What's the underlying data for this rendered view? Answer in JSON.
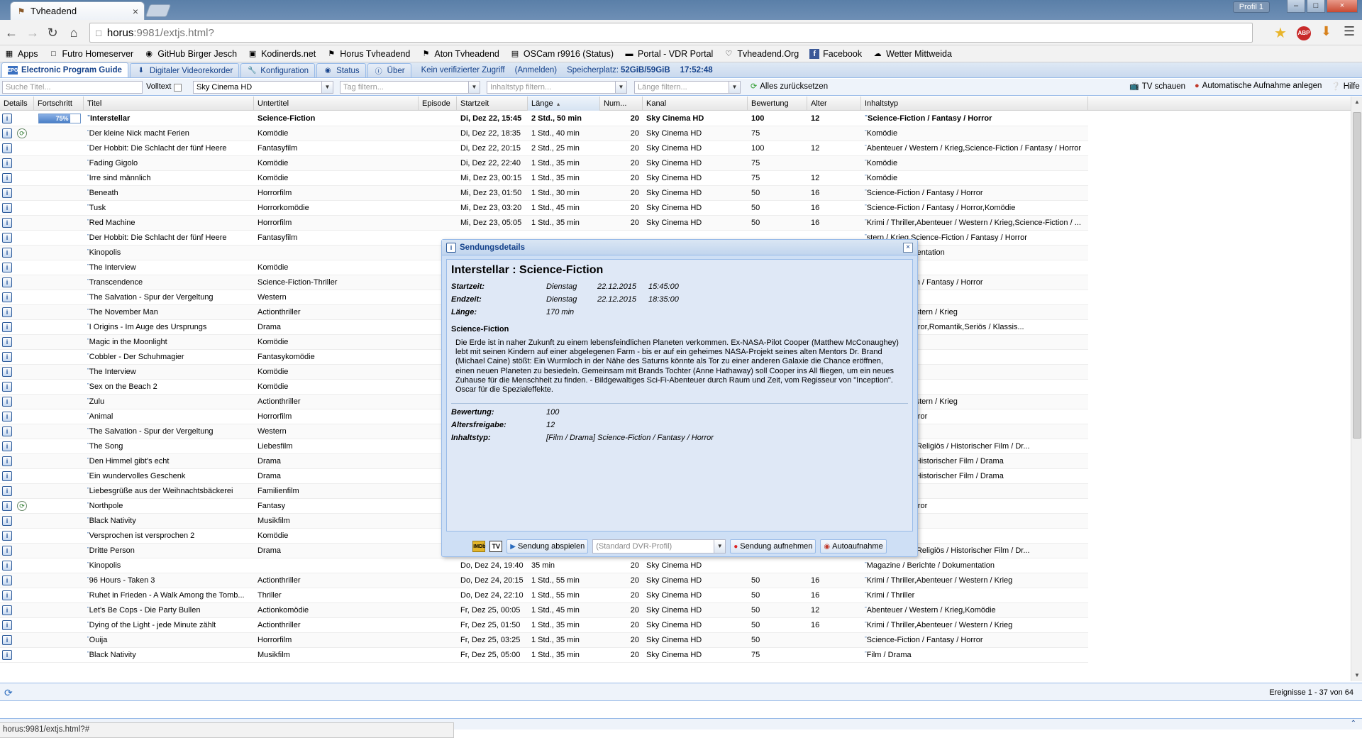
{
  "browser": {
    "tab_title": "Tvheadend",
    "profile": "Profil 1",
    "url_host": "horus",
    "url_path": ":9981/extjs.html?",
    "status_url": "horus:9981/extjs.html?#"
  },
  "bookmarks": [
    {
      "label": "Apps",
      "icon": "apps-grid-icon"
    },
    {
      "label": "Futro Homeserver",
      "icon": "page-icon"
    },
    {
      "label": "GitHub Birger Jesch",
      "icon": "github-icon"
    },
    {
      "label": "Kodinerds.net",
      "icon": "kodinerds-icon"
    },
    {
      "label": "Horus Tvheadend",
      "icon": "tvheadend-icon"
    },
    {
      "label": "Aton Tvheadend",
      "icon": "tvheadend-icon"
    },
    {
      "label": "OSCam r9916 (Status)",
      "icon": "oscam-icon"
    },
    {
      "label": "Portal - VDR Portal",
      "icon": "vdr-icon"
    },
    {
      "label": "Tvheadend.Org",
      "icon": "tvheadend-org-icon"
    },
    {
      "label": "Facebook",
      "icon": "facebook-icon"
    },
    {
      "label": "Wetter Mittweida",
      "icon": "weather-icon"
    }
  ],
  "app_tabs": [
    {
      "label": "Electronic Program Guide",
      "active": true
    },
    {
      "label": "Digitaler Videorekorder"
    },
    {
      "label": "Konfiguration"
    },
    {
      "label": "Status"
    },
    {
      "label": "Über"
    }
  ],
  "app_info": {
    "access": "Kein verifizierter Zugriff",
    "login": "(Anmelden)",
    "storage_label": "Speicherplatz:",
    "storage_value": "52GiB/59GiB",
    "time": "17:52:48"
  },
  "toolbar": {
    "title_placeholder": "Suche Titel...",
    "fulltext_label": "Volltext",
    "channel_value": "Sky Cinema HD",
    "tag_placeholder": "Tag filtern...",
    "content_placeholder": "Inhaltstyp filtern...",
    "length_placeholder": "Länge filtern...",
    "reset_label": "Alles zurücksetzen",
    "watch_tv": "TV schauen",
    "auto_record": "Automatische Aufnahme anlegen",
    "help": "Hilfe"
  },
  "columns": [
    "Details",
    "Fortschritt",
    "Titel",
    "Untertitel",
    "Episode",
    "Startzeit",
    "Länge",
    "Num...",
    "Kanal",
    "Bewertung",
    "Alter",
    "Inhaltstyp"
  ],
  "rows": [
    {
      "progress": 0.75,
      "progress_label": "75%",
      "title": "Interstellar",
      "subtitle": "Science-Fiction",
      "start": "Di, Dez 22, 15:45",
      "length": "2 Std., 50 min",
      "num": "20",
      "channel": "Sky Cinema HD",
      "rating": "100",
      "age": "12",
      "genre": "Science-Fiction / Fantasy / Horror",
      "selected": true
    },
    {
      "title": "Der kleine Nick macht Ferien",
      "subtitle": "Komödie",
      "start": "Di, Dez 22, 18:35",
      "length": "1 Std., 40 min",
      "num": "20",
      "channel": "Sky Cinema HD",
      "rating": "75",
      "age": "",
      "genre": "Komödie",
      "rec": true
    },
    {
      "title": "Der Hobbit: Die Schlacht der fünf Heere",
      "subtitle": "Fantasyfilm",
      "start": "Di, Dez 22, 20:15",
      "length": "2 Std., 25 min",
      "num": "20",
      "channel": "Sky Cinema HD",
      "rating": "100",
      "age": "12",
      "genre": "Abenteuer / Western / Krieg,Science-Fiction / Fantasy / Horror"
    },
    {
      "title": "Fading Gigolo",
      "subtitle": "Komödie",
      "start": "Di, Dez 22, 22:40",
      "length": "1 Std., 35 min",
      "num": "20",
      "channel": "Sky Cinema HD",
      "rating": "75",
      "age": "",
      "genre": "Komödie"
    },
    {
      "title": "Irre sind männlich",
      "subtitle": "Komödie",
      "start": "Mi, Dez 23, 00:15",
      "length": "1 Std., 35 min",
      "num": "20",
      "channel": "Sky Cinema HD",
      "rating": "75",
      "age": "12",
      "genre": "Komödie"
    },
    {
      "title": "Beneath",
      "subtitle": "Horrorfilm",
      "start": "Mi, Dez 23, 01:50",
      "length": "1 Std., 30 min",
      "num": "20",
      "channel": "Sky Cinema HD",
      "rating": "50",
      "age": "16",
      "genre": "Science-Fiction / Fantasy / Horror"
    },
    {
      "title": "Tusk",
      "subtitle": "Horrorkomödie",
      "start": "Mi, Dez 23, 03:20",
      "length": "1 Std., 45 min",
      "num": "20",
      "channel": "Sky Cinema HD",
      "rating": "50",
      "age": "16",
      "genre": "Science-Fiction / Fantasy / Horror,Komödie"
    },
    {
      "title": "Red Machine",
      "subtitle": "Horrorfilm",
      "start": "Mi, Dez 23, 05:05",
      "length": "1 Std., 35 min",
      "num": "20",
      "channel": "Sky Cinema HD",
      "rating": "50",
      "age": "16",
      "genre": "Krimi / Thriller,Abenteuer / Western / Krieg,Science-Fiction / ..."
    },
    {
      "title": "Der Hobbit: Die Schlacht der fünf Heere",
      "subtitle": "Fantasyfilm",
      "genre": "stern / Krieg,Science-Fiction / Fantasy / Horror"
    },
    {
      "title": "Kinopolis",
      "subtitle": "",
      "genre": "richte / Dokumentation"
    },
    {
      "title": "The Interview",
      "subtitle": "Komödie",
      "genre": ""
    },
    {
      "title": "Transcendence",
      "subtitle": "Science-Fiction-Thriller",
      "genre": "Science-Fiction / Fantasy / Horror"
    },
    {
      "title": "The Salvation - Spur der Vergeltung",
      "subtitle": "Western",
      "genre": "stern / Krieg"
    },
    {
      "title": "The November Man",
      "subtitle": "Actionthriller",
      "genre": "benteuer / Western / Krieg"
    },
    {
      "title": "I Origins - Im Auge des Ursprungs",
      "subtitle": "Drama",
      "genre": "/ Fantasy / Horror,Romantik,Seriös / Klassis..."
    },
    {
      "title": "Magic in the Moonlight",
      "subtitle": "Komödie",
      "genre": ""
    },
    {
      "title": "Cobbler - Der Schuhmagier",
      "subtitle": "Fantasykomödie",
      "genre": ""
    },
    {
      "title": "The Interview",
      "subtitle": "Komödie",
      "genre": ""
    },
    {
      "title": "Sex on the Beach 2",
      "subtitle": "Komödie",
      "genre": ""
    },
    {
      "title": "Zulu",
      "subtitle": "Actionthriller",
      "genre": "benteuer / Western / Krieg"
    },
    {
      "title": "Animal",
      "subtitle": "Horrorfilm",
      "genre": "/ Fantasy / Horror"
    },
    {
      "title": "The Salvation - Spur der Vergeltung",
      "subtitle": "Western",
      "genre": "stern / Krieg"
    },
    {
      "title": "The Song",
      "subtitle": "Liebesfilm",
      "genre": "s / Klassisch / Religiös / Historischer Film / Dr..."
    },
    {
      "title": "Den Himmel gibt's echt",
      "subtitle": "Drama",
      "genre": "ch / Religiös / Historischer Film / Drama"
    },
    {
      "title": "Ein wundervolles Geschenk",
      "subtitle": "Drama",
      "genre": "ch / Religiös / Historischer Film / Drama"
    },
    {
      "title": "Liebesgrüße aus der Weihnachtsbäckerei",
      "subtitle": "Familienfilm",
      "genre": ""
    },
    {
      "title": "Northpole",
      "subtitle": "Fantasy",
      "genre": "/ Fantasy / Horror",
      "rec": true
    },
    {
      "title": "Black Nativity",
      "subtitle": "Musikfilm",
      "genre": ""
    },
    {
      "title": "Versprochen ist versprochen 2",
      "subtitle": "Komödie",
      "genre": ""
    },
    {
      "title": "Dritte Person",
      "subtitle": "Drama",
      "genre": "s / Klassisch / Religiös / Historischer Film / Dr..."
    },
    {
      "title": "Kinopolis",
      "subtitle": "",
      "start": "Do, Dez 24, 19:40",
      "length": "35 min",
      "num": "20",
      "channel": "Sky Cinema HD",
      "rating": "",
      "age": "",
      "genre": "Magazine / Berichte / Dokumentation"
    },
    {
      "title": "96 Hours - Taken 3",
      "subtitle": "Actionthriller",
      "start": "Do, Dez 24, 20:15",
      "length": "1 Std., 55 min",
      "num": "20",
      "channel": "Sky Cinema HD",
      "rating": "50",
      "age": "16",
      "genre": "Krimi / Thriller,Abenteuer / Western / Krieg"
    },
    {
      "title": "Ruhet in Frieden - A Walk Among the Tomb...",
      "subtitle": "Thriller",
      "start": "Do, Dez 24, 22:10",
      "length": "1 Std., 55 min",
      "num": "20",
      "channel": "Sky Cinema HD",
      "rating": "50",
      "age": "16",
      "genre": "Krimi / Thriller"
    },
    {
      "title": "Let's Be Cops - Die Party Bullen",
      "subtitle": "Actionkomödie",
      "start": "Fr, Dez 25, 00:05",
      "length": "1 Std., 45 min",
      "num": "20",
      "channel": "Sky Cinema HD",
      "rating": "50",
      "age": "12",
      "genre": "Abenteuer / Western / Krieg,Komödie"
    },
    {
      "title": "Dying of the Light - jede Minute zählt",
      "subtitle": "Actionthriller",
      "start": "Fr, Dez 25, 01:50",
      "length": "1 Std., 35 min",
      "num": "20",
      "channel": "Sky Cinema HD",
      "rating": "50",
      "age": "16",
      "genre": "Krimi / Thriller,Abenteuer / Western / Krieg"
    },
    {
      "title": "Ouija",
      "subtitle": "Horrorfilm",
      "start": "Fr, Dez 25, 03:25",
      "length": "1 Std., 35 min",
      "num": "20",
      "channel": "Sky Cinema HD",
      "rating": "50",
      "age": "",
      "genre": "Science-Fiction / Fantasy / Horror"
    },
    {
      "title": "Black Nativity",
      "subtitle": "Musikfilm",
      "start": "Fr, Dez 25, 05:00",
      "length": "1 Std., 35 min",
      "num": "20",
      "channel": "Sky Cinema HD",
      "rating": "75",
      "age": "",
      "genre": "Film / Drama"
    }
  ],
  "pager": {
    "count": "Ereignisse 1 - 37 von 64"
  },
  "dialog": {
    "header": "Sendungsdetails",
    "title": "Interstellar : Science-Fiction",
    "start_label": "Startzeit:",
    "start_day": "Dienstag",
    "start_date": "22.12.2015",
    "start_time": "15:45:00",
    "end_label": "Endzeit:",
    "end_day": "Dienstag",
    "end_date": "22.12.2015",
    "end_time": "18:35:00",
    "length_label": "Länge:",
    "length_value": "170 min",
    "genre": "Science-Fiction",
    "description": "Die Erde ist in naher Zukunft zu einem lebensfeindlichen Planeten verkommen. Ex-NASA-Pilot Cooper (Matthew McConaughey) lebt mit seinen Kindern auf einer abgelegenen Farm - bis er auf ein geheimes NASA-Projekt seines alten Mentors Dr. Brand (Michael Caine) stößt: Ein Wurmloch in der Nähe des Saturns könnte als Tor zu einer anderen Galaxie die Chance eröffnen, einen neuen Planeten zu besiedeln. Gemeinsam mit Brands Tochter (Anne Hathaway) soll Cooper ins All fliegen, um ein neues Zuhause für die Menschheit zu finden. - Bildgewaltiges Sci-Fi-Abenteuer durch Raum und Zeit, vom Regisseur von \"Inception\". Oscar für die Spezialeffekte.",
    "rating_label": "Bewertung:",
    "rating_value": "100",
    "age_label": "Altersfreigabe:",
    "age_value": "12",
    "content_label": "Inhaltstyp:",
    "content_value": "[Film / Drama] Science-Fiction / Fantasy / Horror",
    "imdb": "IMDb",
    "tv": "TV",
    "play": "Sendung abspielen",
    "profile_placeholder": "(Standard DVR-Profil)",
    "record": "Sendung aufnehmen",
    "autorecord": "Autoaufnahme"
  }
}
